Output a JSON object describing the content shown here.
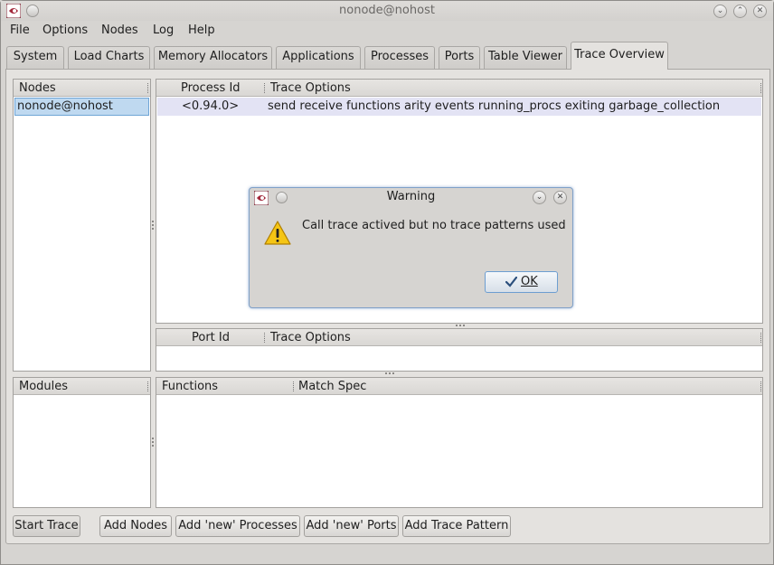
{
  "window": {
    "title": "nonode@nohost"
  },
  "menu": {
    "items": [
      "File",
      "Options",
      "Nodes",
      "Log",
      "Help"
    ]
  },
  "tabs": [
    "System",
    "Load Charts",
    "Memory Allocators",
    "Applications",
    "Processes",
    "Ports",
    "Table Viewer",
    "Trace Overview"
  ],
  "active_tab": "Trace Overview",
  "nodes_panel": {
    "header": "Nodes",
    "items": [
      "nonode@nohost"
    ]
  },
  "process_panel": {
    "headers": [
      "Process Id",
      "Trace Options"
    ],
    "rows": [
      {
        "pid": "<0.94.0>",
        "options": "send receive functions arity events running_procs exiting garbage_collection"
      }
    ]
  },
  "port_panel": {
    "headers": [
      "Port Id",
      "Trace Options"
    ]
  },
  "modules_panel": {
    "header": "Modules"
  },
  "functions_panel": {
    "headers": [
      "Functions",
      "Match Spec"
    ]
  },
  "buttons": [
    "Start Trace",
    "Add Nodes",
    "Add 'new' Processes",
    "Add 'new' Ports",
    "Add Trace Pattern"
  ],
  "dialog": {
    "title": "Warning",
    "message": "Call trace actived but no trace patterns used",
    "ok_label": "OK"
  },
  "icons": {
    "app": "erlang-icon",
    "warning": "warning-icon",
    "ok": "checkmark-icon"
  },
  "colors": {
    "selection": "#bfd9f0",
    "row_highlight": "#e3e3f4",
    "dialog_border": "#7fa0c8"
  }
}
